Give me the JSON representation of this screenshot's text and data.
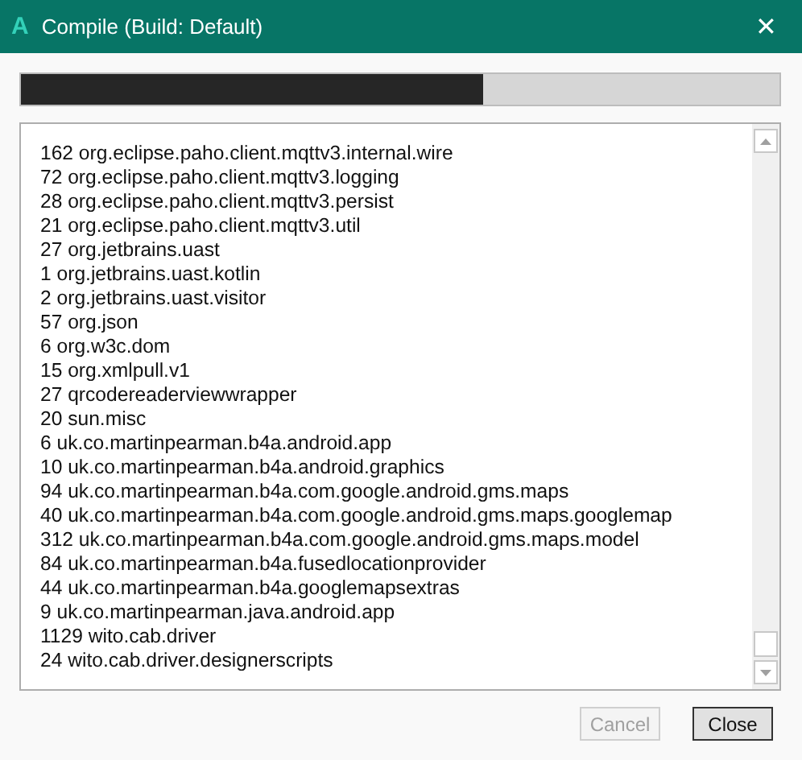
{
  "window": {
    "title": "Compile (Build: Default)",
    "logo": "A",
    "close": "✕"
  },
  "progress": {
    "level": 0.61
  },
  "log": {
    "lines": [
      "162 org.eclipse.paho.client.mqttv3.internal.wire",
      "72 org.eclipse.paho.client.mqttv3.logging",
      "28 org.eclipse.paho.client.mqttv3.persist",
      "21 org.eclipse.paho.client.mqttv3.util",
      "27 org.jetbrains.uast",
      "1 org.jetbrains.uast.kotlin",
      "2 org.jetbrains.uast.visitor",
      "57 org.json",
      "6 org.w3c.dom",
      "15 org.xmlpull.v1",
      "27 qrcodereaderviewwrapper",
      "20 sun.misc",
      "6 uk.co.martinpearman.b4a.android.app",
      "10 uk.co.martinpearman.b4a.android.graphics",
      "94 uk.co.martinpearman.b4a.com.google.android.gms.maps",
      "40 uk.co.martinpearman.b4a.com.google.android.gms.maps.googlemap",
      "312 uk.co.martinpearman.b4a.com.google.android.gms.maps.model",
      "84 uk.co.martinpearman.b4a.fusedlocationprovider",
      "44 uk.co.martinpearman.b4a.googlemapsextras",
      "9 uk.co.martinpearman.java.android.app",
      "1129 wito.cab.driver",
      "24 wito.cab.driver.designerscripts"
    ]
  },
  "buttons": [
    {
      "label": "Cancel",
      "disabled": true
    },
    {
      "label": "Close",
      "disabled": false
    }
  ]
}
